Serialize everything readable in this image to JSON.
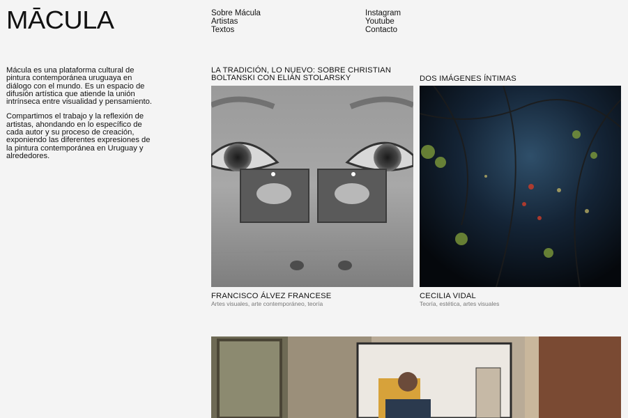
{
  "logo": "MĀCULA",
  "nav": {
    "col1": [
      "Sobre Mácula",
      "Artistas",
      "Textos"
    ],
    "col2": [
      "Instagram",
      "Youtube",
      "Contacto"
    ]
  },
  "intro": {
    "p1": "Mácula es una plataforma cultural de pintura contemporánea uruguaya en diálogo con el mundo. Es un espacio de difusión artística que atiende la unión intrínseca entre visualidad y pensamiento.",
    "p2": "Compartimos el trabajo y la reflexión de artistas, ahondando en lo específico de cada autor y su proceso de creación, exponiendo las diferentes expresiones de la pintura contemporánea en Uruguay y alrededores."
  },
  "cards": [
    {
      "title": "LA TRADICIÓN, LO NUEVO: SOBRE CHRISTIAN BOLTANSKI CON ELIÁN STOLARSKY",
      "author": "FRANCISCO ÁLVEZ FRANCESE",
      "tags": "Artes visuales, arte contemporáneo, teoría"
    },
    {
      "title": "DOS IMÁGENES ÍNTIMAS",
      "author": "CECILIA VIDAL",
      "tags": "Teoría, estética, artes visuales"
    }
  ]
}
